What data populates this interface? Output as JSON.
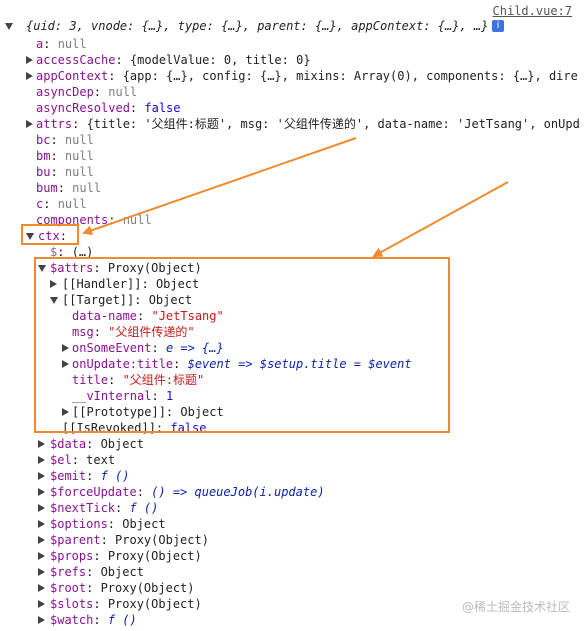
{
  "source_link": "Child.vue:7",
  "header_text": "{uid: 3, vnode: {…}, type: {…}, parent: {…}, appContext: {…}, …}",
  "info_badge": "i",
  "colors": {
    "highlight": "#f08a2f"
  },
  "props": [
    {
      "k": "a",
      "v": "null"
    },
    {
      "k": "accessCache",
      "v": "{modelValue: 0, title: 0}"
    },
    {
      "k": "appContext",
      "v": "{app: {…}, config: {…}, mixins: Array(0), components: {…}, dire"
    },
    {
      "k": "asyncDep",
      "v": "null"
    },
    {
      "k": "asyncResolved",
      "v": "false"
    },
    {
      "k": "attrs",
      "v": "{title: '父组件:标题', msg: '父组件传递的', data-name: 'JetTsang', onUpd"
    },
    {
      "k": "bc",
      "v": "null"
    },
    {
      "k": "bm",
      "v": "null"
    },
    {
      "k": "bu",
      "v": "null"
    },
    {
      "k": "bum",
      "v": "null"
    },
    {
      "k": "c",
      "v": "null"
    },
    {
      "k": "components",
      "v": "null"
    },
    {
      "k": "ctx",
      "v": ""
    },
    {
      "k": "$",
      "v": "(…)"
    },
    {
      "k": "$attrs",
      "v": "Proxy(Object)"
    },
    {
      "k": "[[Handler]]",
      "v": "Object"
    },
    {
      "k": "[[Target]]",
      "v": "Object"
    },
    {
      "k": "data-name",
      "v": "\"JetTsang\""
    },
    {
      "k": "msg",
      "v": "\"父组件传递的\""
    },
    {
      "k": "onSomeEvent",
      "v": "e => {…}"
    },
    {
      "k": "onUpdate:title",
      "v": "$event => $setup.title = $event"
    },
    {
      "k": "title",
      "v": "\"父组件:标题\""
    },
    {
      "k": "__vInternal",
      "v": "1"
    },
    {
      "k": "[[Prototype]]",
      "v": "Object"
    },
    {
      "k": "[[IsRevoked]]",
      "v": "false"
    },
    {
      "k": "$data",
      "v": "Object"
    },
    {
      "k": "$el",
      "v": "text"
    },
    {
      "k": "$emit",
      "v": "f ()"
    },
    {
      "k": "$forceUpdate",
      "v": "() => queueJob(i.update)"
    },
    {
      "k": "$nextTick",
      "v": "f ()"
    },
    {
      "k": "$options",
      "v": "Object"
    },
    {
      "k": "$parent",
      "v": "Proxy(Object)"
    },
    {
      "k": "$props",
      "v": "Proxy(Object)"
    },
    {
      "k": "$refs",
      "v": "Object"
    },
    {
      "k": "$root",
      "v": "Proxy(Object)"
    },
    {
      "k": "$slots",
      "v": "Proxy(Object)"
    },
    {
      "k": "$watch",
      "v": "f ()"
    }
  ],
  "watermark": "@稀土掘金技术社区"
}
